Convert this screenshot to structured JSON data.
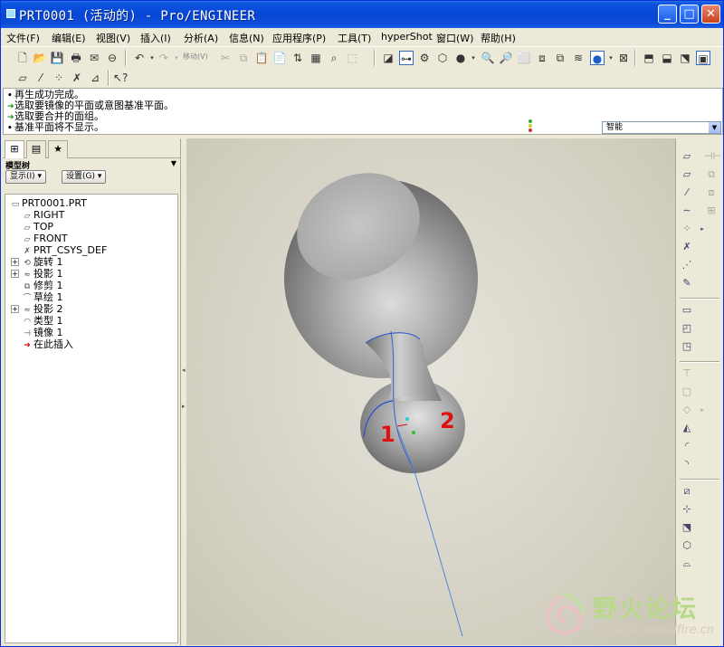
{
  "window": {
    "title": "PRT0001 (活动的) - Pro/ENGINEER",
    "controls": {
      "minimize": "_",
      "maximize": "□",
      "close": "✕"
    }
  },
  "menu": {
    "items": [
      "文件(F)",
      "编辑(E)",
      "视图(V)",
      "插入(I)",
      "分析(A)",
      "信息(N)",
      "应用程序(P)",
      "工具(T)",
      "hyperShot",
      "窗口(W)",
      "帮助(H)"
    ]
  },
  "toolbar": {
    "move_label": "移动(V)"
  },
  "messages": [
    {
      "marker": "dot",
      "text": "再生成功完成。"
    },
    {
      "marker": "arrow",
      "text": "选取要镜像的平面或意图基准平面。"
    },
    {
      "marker": "arrow",
      "text": "选取要合并的面组。"
    },
    {
      "marker": "dot",
      "text": "基准平面将不显示。"
    }
  ],
  "filter": {
    "value": "智能"
  },
  "navigator": {
    "header": "模型树",
    "show_button": "显示(I) ▾",
    "settings_button": "设置(G) ▾",
    "tree": [
      {
        "label": "PRT0001.PRT",
        "icon": "part-icon",
        "expand": false,
        "indent": 0
      },
      {
        "label": "RIGHT",
        "icon": "datum-plane-icon",
        "expand": false,
        "indent": 1
      },
      {
        "label": "TOP",
        "icon": "datum-plane-icon",
        "expand": false,
        "indent": 1
      },
      {
        "label": "FRONT",
        "icon": "datum-plane-icon",
        "expand": false,
        "indent": 1
      },
      {
        "label": "PRT_CSYS_DEF",
        "icon": "csys-icon",
        "expand": false,
        "indent": 1
      },
      {
        "label": "旋转 1",
        "icon": "revolve-icon",
        "expand": true,
        "indent": 1
      },
      {
        "label": "投影 1",
        "icon": "projection-icon",
        "expand": true,
        "indent": 1
      },
      {
        "label": "修剪 1",
        "icon": "trim-icon",
        "expand": false,
        "indent": 1
      },
      {
        "label": "草绘 1",
        "icon": "sketch-icon",
        "expand": false,
        "indent": 1
      },
      {
        "label": "投影 2",
        "icon": "projection-icon",
        "expand": true,
        "indent": 1
      },
      {
        "label": "类型 1",
        "icon": "type-icon",
        "expand": false,
        "indent": 1
      },
      {
        "label": "镜像 1",
        "icon": "mirror-icon",
        "expand": false,
        "indent": 1
      },
      {
        "label": "在此插入",
        "icon": "insert-here-icon",
        "expand": false,
        "indent": 1
      }
    ]
  },
  "viewport": {
    "label_1": "1",
    "label_2": "2"
  },
  "watermark": {
    "cn": "野火论坛",
    "url": "www.proewildfire.cn"
  }
}
